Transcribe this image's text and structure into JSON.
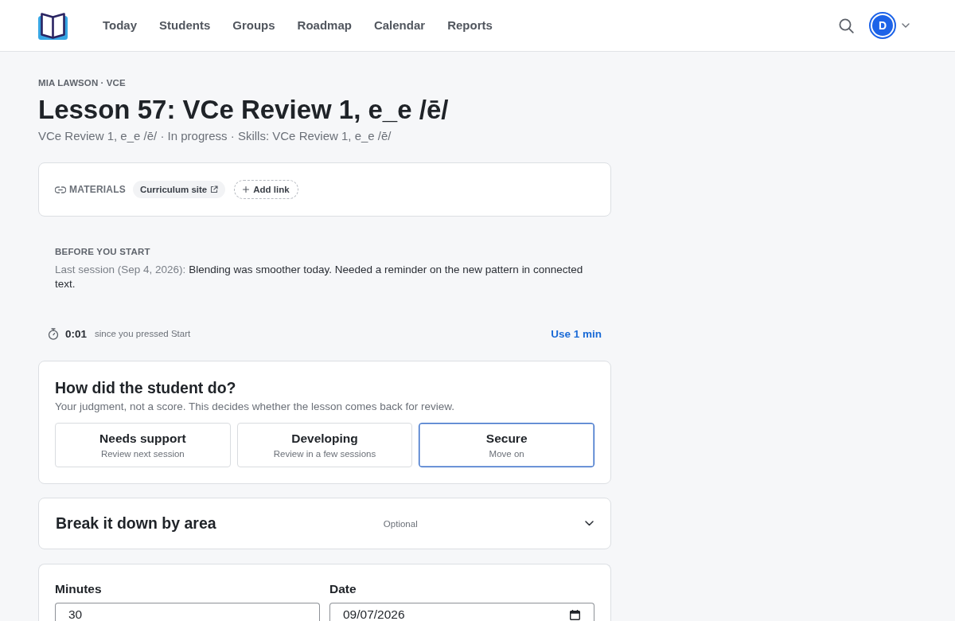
{
  "header": {
    "nav": [
      {
        "label": "Today",
        "selected": false
      },
      {
        "label": "Students",
        "selected": false
      },
      {
        "label": "Groups",
        "selected": false
      },
      {
        "label": "Roadmap",
        "selected": false
      },
      {
        "label": "Calendar",
        "selected": false
      },
      {
        "label": "Reports",
        "selected": false
      }
    ],
    "avatar": {
      "initial": "D"
    }
  },
  "lesson": {
    "eyebrow": "MIA LAWSON · VCE",
    "title": "Lesson 57: VCe Review 1, e_e /ē/",
    "subtitle": "VCe Review 1, e_e /ē/ · In progress · Skills: VCe Review 1, e_e /ē/"
  },
  "materials": {
    "label": "MATERIALS",
    "links": [
      {
        "label": "Curriculum site",
        "kind": "external"
      }
    ],
    "add_button": "Add link"
  },
  "before_you_start": {
    "heading": "BEFORE YOU START",
    "label": "Last session (Sep 4, 2026):",
    "note": "Blending was smoother today. Needed a reminder on the new pattern in connected text."
  },
  "timer": {
    "elapsed": "0:01",
    "caption": "since you pressed Start",
    "action": "Use 1 min"
  },
  "rating": {
    "title": "How did the student do?",
    "subtitle": "Your judgment, not a score. This decides whether the lesson comes back for review.",
    "options": [
      {
        "label": "Needs support",
        "hint": "Review next session",
        "selected": false
      },
      {
        "label": "Developing",
        "hint": "Review in a few sessions",
        "selected": false
      },
      {
        "label": "Secure",
        "hint": "Move on",
        "selected": true
      }
    ]
  },
  "breakdown": {
    "title": "Break it down by area",
    "badge": "Optional",
    "expanded": false
  },
  "log": {
    "fields": [
      {
        "label": "Minutes",
        "kind": "number",
        "value": "30"
      },
      {
        "label": "Date",
        "kind": "date",
        "value": "09/07/2026"
      }
    ]
  }
}
